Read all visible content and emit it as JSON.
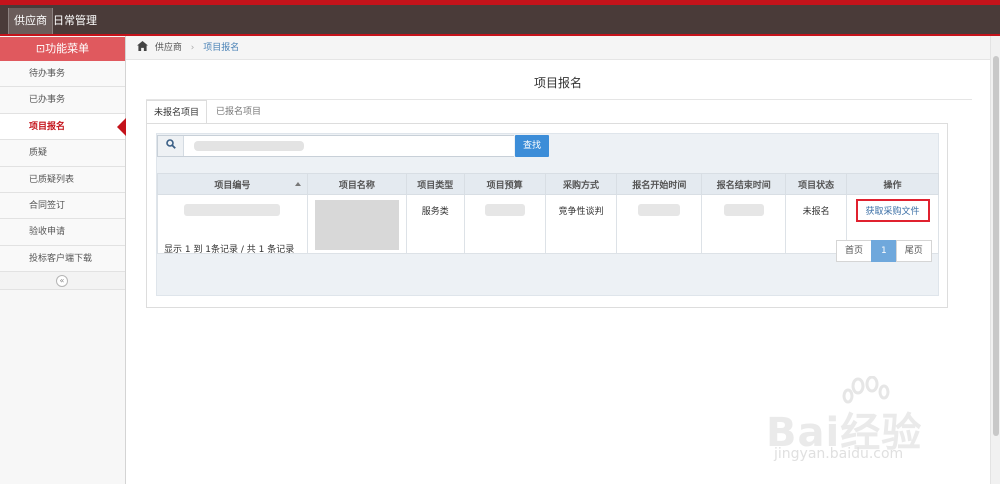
{
  "topbar": {
    "tab1": "供应商",
    "tab2": "日常管理"
  },
  "sidebar": {
    "title": "功能菜单",
    "items": [
      {
        "label": "待办事务"
      },
      {
        "label": "已办事务"
      },
      {
        "label": "项目报名"
      },
      {
        "label": "质疑"
      },
      {
        "label": "已质疑列表"
      },
      {
        "label": "合同签订"
      },
      {
        "label": "验收申请"
      },
      {
        "label": "投标客户端下载"
      }
    ],
    "active_index": 2
  },
  "breadcrumb": {
    "home": "供应商",
    "current": "项目报名"
  },
  "page": {
    "title": "项目报名"
  },
  "tabs": {
    "unregistered": "未报名项目",
    "registered": "已报名项目"
  },
  "search": {
    "placeholder": "",
    "button": "查找"
  },
  "table": {
    "headers": [
      "项目编号",
      "项目名称",
      "项目类型",
      "项目预算",
      "采购方式",
      "报名开始时间",
      "报名结束时间",
      "项目状态",
      "操作"
    ],
    "rows": [
      {
        "type": "服务类",
        "method": "竞争性谈判",
        "status": "未报名",
        "action": "获取采购文件"
      }
    ]
  },
  "pagination": {
    "summary": "显示 1 到 1条记录 / 共 1 条记录",
    "first": "首页",
    "current": "1",
    "last": "尾页"
  },
  "watermark": {
    "brand": "Bai经验",
    "url": "jingyan.baidu.com"
  },
  "colors": {
    "accent_red": "#c4131b",
    "topbar": "#4a3b39",
    "menu_header": "#e0595e",
    "primary_blue": "#3c8dd8"
  }
}
